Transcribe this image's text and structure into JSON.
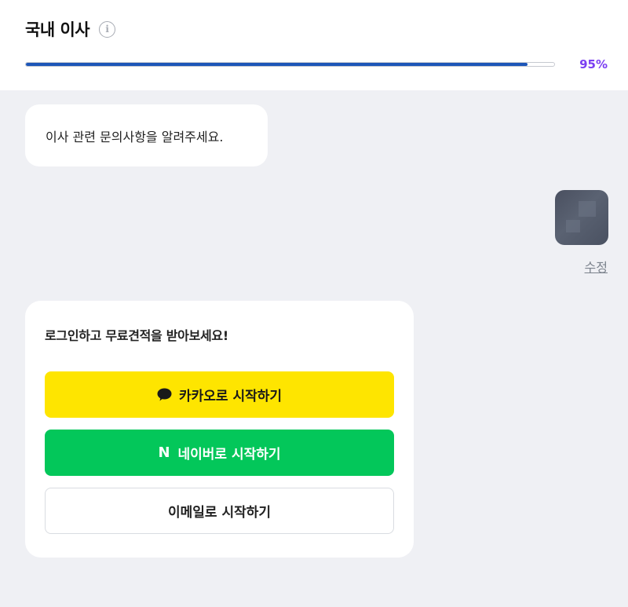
{
  "header": {
    "title": "국내 이사",
    "info_icon": "info-icon",
    "progress_percent": 95,
    "progress_label": "95%",
    "progress_color": "#1d56b8",
    "percent_color": "#7b3ff2"
  },
  "chat": {
    "bot_message": "이사 관련 문의사항을 알려주세요.",
    "user_reply_image": "blurred-image-thumbnail",
    "edit_label": "수정"
  },
  "login_card": {
    "title": "로그인하고 무료견적을 받아보세요!",
    "kakao": {
      "label": "카카오로 시작하기",
      "icon": "speech-bubble-icon",
      "color": "#fee500"
    },
    "naver": {
      "label": "네이버로 시작하기",
      "icon": "naver-n-icon",
      "icon_text": "N",
      "color": "#03c75a"
    },
    "email": {
      "label": "이메일로 시작하기"
    }
  }
}
